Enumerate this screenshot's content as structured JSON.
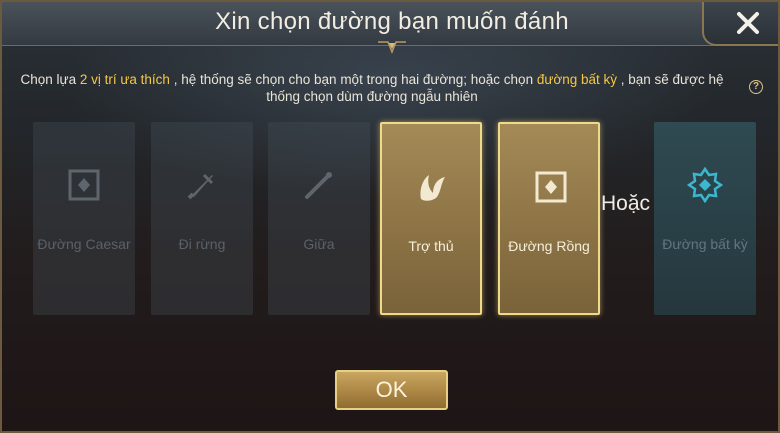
{
  "dialog": {
    "title": "Xin chọn đường bạn muốn đánh",
    "close_icon": "close-icon"
  },
  "description": {
    "part1": "Chọn lựa ",
    "highlight1": "2 vị trí ưa thích",
    "part2": " , hệ thống sẽ chọn cho bạn một trong hai đường; hoặc chọn ",
    "highlight2": "đường bất kỳ",
    "part3": " , bạn sẽ được hệ thống chọn dùm đường ngẫu nhiên",
    "help_icon": "?"
  },
  "roles": [
    {
      "label": "Đường Caesar",
      "icon": "square-diamond-icon",
      "selected": false
    },
    {
      "label": "Đi rừng",
      "icon": "dagger-icon",
      "selected": false
    },
    {
      "label": "Giữa",
      "icon": "staff-icon",
      "selected": false
    },
    {
      "label": "Trợ thủ",
      "icon": "wing-icon",
      "selected": true
    },
    {
      "label": "Đường Rồng",
      "icon": "square-diamond-icon",
      "selected": true
    },
    {
      "label": "Đường bất kỳ",
      "icon": "star-badge-icon",
      "selected": false
    }
  ],
  "or_label": "Hoặc",
  "ok_button": "OK",
  "colors": {
    "highlight": "#f4c842",
    "selected_border": "#efd98a",
    "any_lane_icon": "#3bb8d0"
  }
}
